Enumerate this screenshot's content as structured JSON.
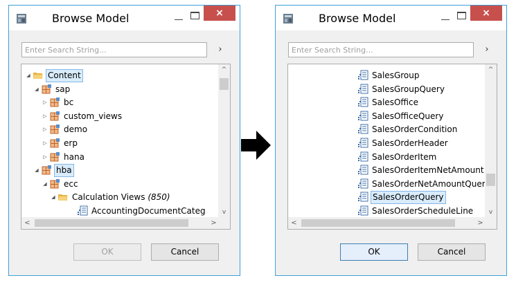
{
  "colors": {
    "accent": "#3fa0d8",
    "close": "#c7504d",
    "folder": "#f2c660",
    "pkg": "#e07b2a"
  },
  "left": {
    "title": "Browse Model",
    "close_glyph": "×",
    "search": {
      "placeholder": "Enter Search String...",
      "value": "",
      "go": "›"
    },
    "tree": [
      {
        "label": "Content",
        "icon": "folder-open-icon",
        "expand": "◢",
        "selected": true
      },
      {
        "label": "sap",
        "icon": "package-icon",
        "expand": "◢"
      },
      {
        "label": "bc",
        "icon": "package-icon",
        "expand": "▷"
      },
      {
        "label": "custom_views",
        "icon": "package-icon",
        "expand": "▷"
      },
      {
        "label": "demo",
        "icon": "package-icon",
        "expand": "▷"
      },
      {
        "label": "erp",
        "icon": "package-icon",
        "expand": "▷"
      },
      {
        "label": "hana",
        "icon": "package-icon",
        "expand": "▷"
      },
      {
        "label": "hba",
        "icon": "package-icon",
        "expand": "◢",
        "selected": true
      },
      {
        "label": "ecc",
        "icon": "package-icon",
        "expand": "◢"
      },
      {
        "label": "Calculation Views",
        "count": "(850)",
        "icon": "folder-open-icon",
        "expand": "◢"
      },
      {
        "label": "AccountingDocumentCateg",
        "icon": "calc-view-icon",
        "expand": ""
      }
    ],
    "ok_label": "OK",
    "cancel_label": "Cancel"
  },
  "right": {
    "title": "Browse Model",
    "close_glyph": "×",
    "search": {
      "placeholder": "Enter Search String...",
      "value": "",
      "go": "›"
    },
    "list": [
      {
        "label": "SalesGroup"
      },
      {
        "label": "SalesGroupQuery"
      },
      {
        "label": "SalesOffice"
      },
      {
        "label": "SalesOfficeQuery"
      },
      {
        "label": "SalesOrderCondition"
      },
      {
        "label": "SalesOrderHeader"
      },
      {
        "label": "SalesOrderItem"
      },
      {
        "label": "SalesOrderItemNetAmount"
      },
      {
        "label": "SalesOrderNetAmountQuer"
      },
      {
        "label": "SalesOrderQuery",
        "selected": true
      },
      {
        "label": "SalesOrderScheduleLine"
      }
    ],
    "ok_label": "OK",
    "cancel_label": "Cancel"
  },
  "scroll": {
    "up": "^",
    "down": "v",
    "left": "<",
    "right": ">"
  }
}
